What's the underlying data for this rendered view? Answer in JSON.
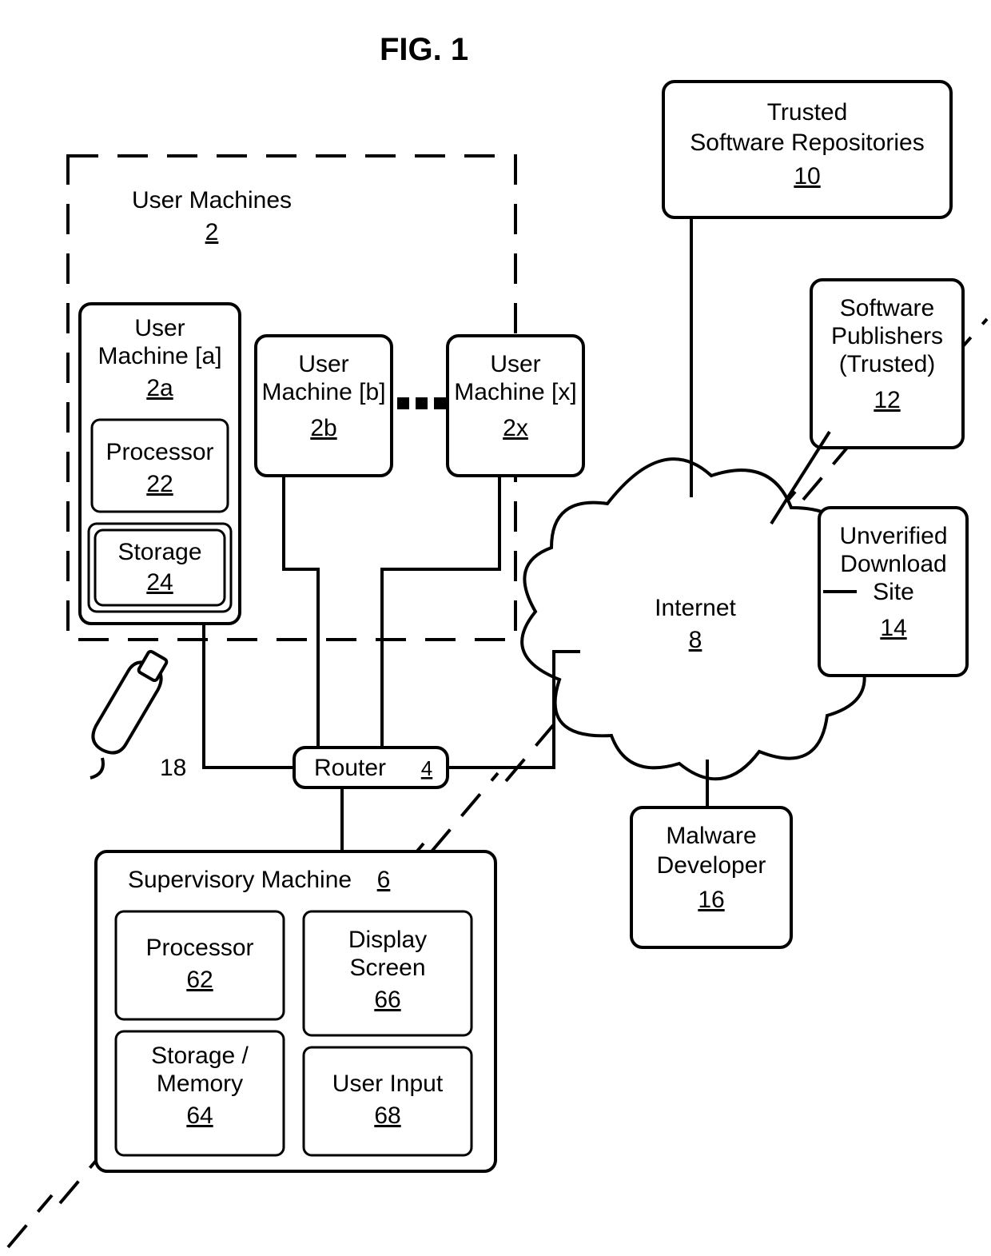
{
  "figure_title": "FIG. 1",
  "user_machines_group": {
    "label": "User Machines",
    "ref": "2"
  },
  "user_machine_a": {
    "line1": "User",
    "line2": "Machine [a]",
    "ref": "2a",
    "proc_label": "Processor",
    "proc_ref": "22",
    "storage_label": "Storage",
    "storage_ref": "24"
  },
  "user_machine_b": {
    "line1": "User",
    "line2": "Machine [b]",
    "ref": "2b"
  },
  "user_machine_x": {
    "line1": "User",
    "line2": "Machine [x]",
    "ref": "2x"
  },
  "router": {
    "label": "Router",
    "ref": "4"
  },
  "supervisory": {
    "label": "Supervisory Machine",
    "ref": "6",
    "proc_label": "Processor",
    "proc_ref": "62",
    "mem_line1": "Storage /",
    "mem_line2": "Memory",
    "mem_ref": "64",
    "disp_line1": "Display",
    "disp_line2": "Screen",
    "disp_ref": "66",
    "input_label": "User Input",
    "input_ref": "68"
  },
  "internet": {
    "label": "Internet",
    "ref": "8"
  },
  "repo": {
    "line1": "Trusted",
    "line2": "Software Repositories",
    "ref": "10"
  },
  "publishers": {
    "line1": "Software",
    "line2": "Publishers",
    "line3": "(Trusted)",
    "ref": "12"
  },
  "download_site": {
    "line1": "Unverified",
    "line2": "Download",
    "line3": "Site",
    "ref": "14"
  },
  "malware": {
    "line1": "Malware",
    "line2": "Developer",
    "ref": "16"
  },
  "usb": {
    "ref": "18"
  }
}
